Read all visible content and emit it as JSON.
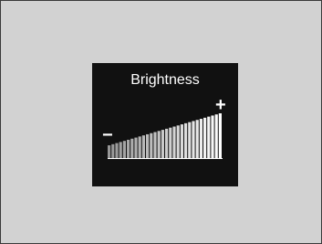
{
  "brightness_panel": {
    "title": "Brightness",
    "decrease_symbol": "−",
    "increase_symbol": "+",
    "bar_count": 30,
    "level": 1.0,
    "colors": {
      "background": "#d2d2d2",
      "panel": "#111111",
      "bar": "#ffffff",
      "bar_dim": "#9a9a9a"
    }
  }
}
